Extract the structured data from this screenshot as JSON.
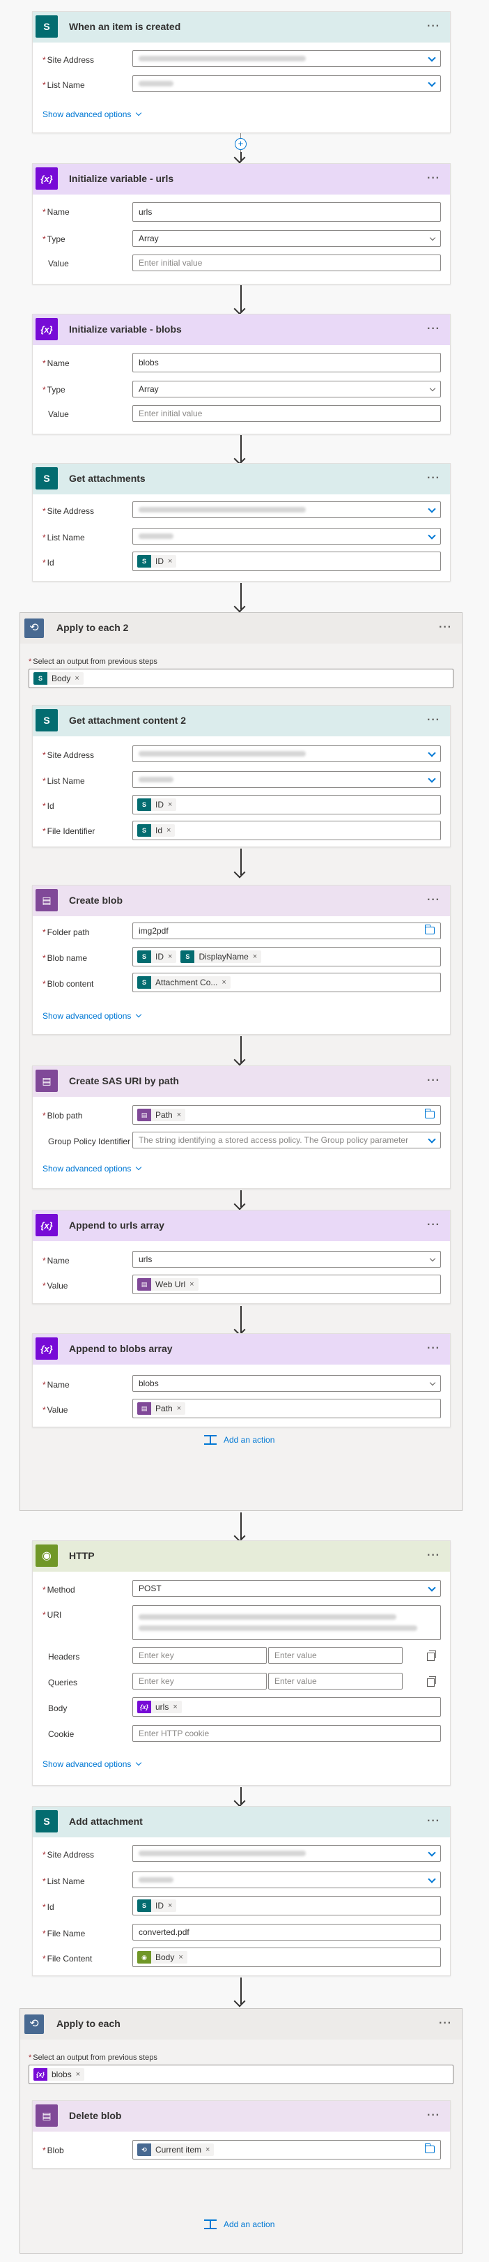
{
  "colors": {
    "sharepoint": "#036c70",
    "sharepoint_header": "#dbecec",
    "variable": "#770bd6",
    "variable_header": "#e9d9f7",
    "blob": "#804998",
    "blob_header": "#ede1f1",
    "http": "#709727",
    "http_header": "#e6ecd9",
    "control_header": "#edebe9",
    "link": "#0078d4",
    "required": "#a4262c"
  },
  "trigger": {
    "title": "When an item is created",
    "icon": "sharepoint-icon",
    "site_address_label": "Site Address",
    "list_name_label": "List Name",
    "advanced": "Show advanced options"
  },
  "init_urls": {
    "title": "Initialize variable - urls",
    "icon": "variable-icon",
    "name_label": "Name",
    "name_value": "urls",
    "type_label": "Type",
    "type_value": "Array",
    "value_label": "Value",
    "value_placeholder": "Enter initial value"
  },
  "init_blobs": {
    "title": "Initialize variable - blobs",
    "icon": "variable-icon",
    "name_label": "Name",
    "name_value": "blobs",
    "type_label": "Type",
    "type_value": "Array",
    "value_label": "Value",
    "value_placeholder": "Enter initial value"
  },
  "get_attachments": {
    "title": "Get attachments",
    "site_address_label": "Site Address",
    "list_name_label": "List Name",
    "id_label": "Id",
    "id_token": "ID"
  },
  "apply_each_2": {
    "title": "Apply to each 2",
    "select_label": "Select an output from previous steps",
    "token": "Body",
    "get_content": {
      "title": "Get attachment content 2",
      "site_address_label": "Site Address",
      "list_name_label": "List Name",
      "id_label": "Id",
      "id_token": "ID",
      "file_identifier_label": "File Identifier",
      "file_identifier_token": "Id"
    },
    "create_blob": {
      "title": "Create blob",
      "folder_label": "Folder path",
      "folder_value": "img2pdf",
      "blob_name_label": "Blob name",
      "blob_name_token1": "ID",
      "blob_name_token2": "DisplayName",
      "blob_content_label": "Blob content",
      "blob_content_token": "Attachment Co...",
      "advanced": "Show advanced options"
    },
    "create_sas": {
      "title": "Create SAS URI by path",
      "blob_path_label": "Blob path",
      "blob_path_token": "Path",
      "policy_label": "Group Policy Identifier",
      "policy_placeholder": "The string identifying a stored access policy. The Group policy parameter",
      "advanced": "Show advanced options"
    },
    "append_urls": {
      "title": "Append to urls array",
      "name_label": "Name",
      "name_value": "urls",
      "value_label": "Value",
      "value_token": "Web Url"
    },
    "append_blobs": {
      "title": "Append to blobs array",
      "name_label": "Name",
      "name_value": "blobs",
      "value_label": "Value",
      "value_token": "Path"
    },
    "add_action": "Add an action"
  },
  "http": {
    "title": "HTTP",
    "method_label": "Method",
    "method_value": "POST",
    "uri_label": "URI",
    "headers_label": "Headers",
    "queries_label": "Queries",
    "key_placeholder": "Enter key",
    "value_placeholder": "Enter value",
    "body_label": "Body",
    "body_token": "urls",
    "cookie_label": "Cookie",
    "cookie_placeholder": "Enter HTTP cookie",
    "advanced": "Show advanced options"
  },
  "add_attachment": {
    "title": "Add attachment",
    "site_address_label": "Site Address",
    "list_name_label": "List Name",
    "id_label": "Id",
    "id_token": "ID",
    "file_name_label": "File Name",
    "file_name_value": "converted.pdf",
    "file_content_label": "File Content",
    "file_content_token": "Body"
  },
  "apply_each": {
    "title": "Apply to each",
    "select_label": "Select an output from previous steps",
    "token": "blobs",
    "delete_blob": {
      "title": "Delete blob",
      "blob_label": "Blob",
      "blob_token": "Current item"
    },
    "add_action": "Add an action"
  },
  "glyphs": {
    "sharepoint": "S",
    "variable": "{x}",
    "blob": "▤",
    "http": "◉",
    "loop": "⟲",
    "dots": "···",
    "asterisk": "*",
    "remove": "×",
    "add": "+"
  }
}
